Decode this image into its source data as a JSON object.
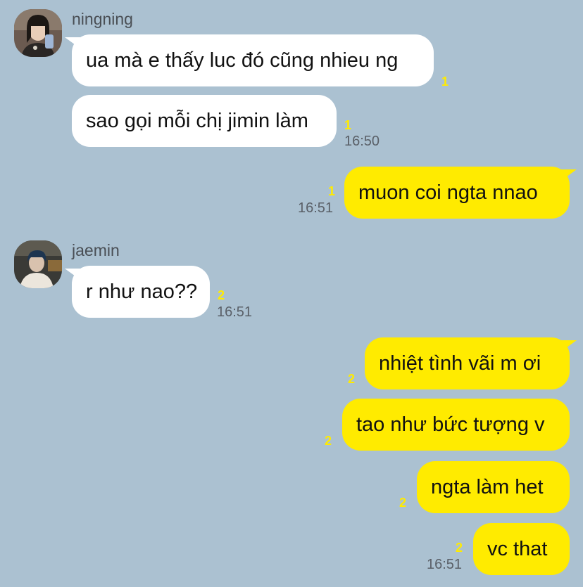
{
  "chat": {
    "background_color": "#abc1d1",
    "incoming_bubble_color": "#ffffff",
    "outgoing_bubble_color": "#ffeb00",
    "unread_color": "#ffeb00",
    "groups": [
      {
        "sender": "ningning",
        "avatar": "ningning-avatar",
        "messages": [
          {
            "text": "ua mà e thấy luc đó cũng nhieu ng",
            "unread": "1",
            "time": ""
          },
          {
            "text": "sao gọi mỗi chị jimin làm",
            "unread": "1",
            "time": "16:50"
          }
        ]
      },
      {
        "sender": "me",
        "messages": [
          {
            "text": "muon coi ngta nnao",
            "unread": "1",
            "time": "16:51"
          }
        ]
      },
      {
        "sender": "jaemin",
        "avatar": "jaemin-avatar",
        "messages": [
          {
            "text": "r như nao??",
            "unread": "2",
            "time": "16:51"
          }
        ]
      },
      {
        "sender": "me",
        "messages": [
          {
            "text": "nhiệt tình vãi m ơi",
            "unread": "2",
            "time": ""
          },
          {
            "text": "tao như bức tượng v",
            "unread": "2",
            "time": ""
          },
          {
            "text": "ngta làm het",
            "unread": "2",
            "time": ""
          },
          {
            "text": "vc that",
            "unread": "2",
            "time": "16:51"
          }
        ]
      }
    ]
  }
}
